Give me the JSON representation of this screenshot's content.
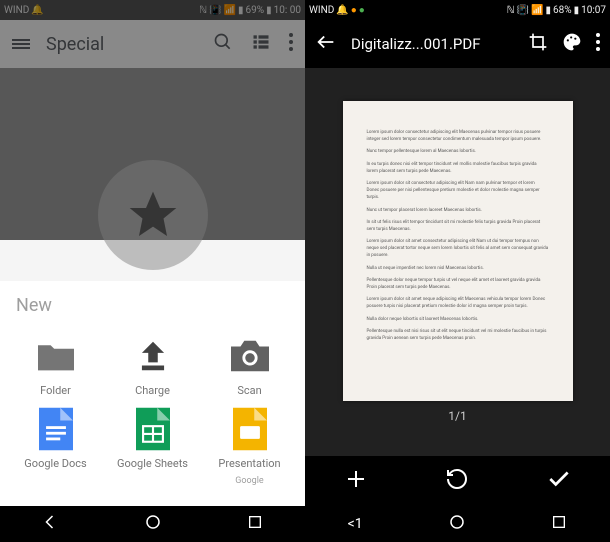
{
  "left": {
    "statusbar": {
      "carrier": "WIND",
      "battery": "69%",
      "time": "10: 00"
    },
    "appbar": {
      "title": "Special"
    },
    "sheet": {
      "title": "New",
      "items": [
        {
          "label": "Folder"
        },
        {
          "label": "Charge"
        },
        {
          "label": "Scan"
        },
        {
          "label": "Google Docs"
        },
        {
          "label": "Google Sheets"
        },
        {
          "label": "Presentation",
          "sublabel": "Google"
        }
      ]
    }
  },
  "right": {
    "statusbar": {
      "carrier": "WIND",
      "battery": "68%",
      "time": "10:07"
    },
    "appbar": {
      "title": "Digitalizz...001.PDF"
    },
    "page_counter": "1/1"
  }
}
